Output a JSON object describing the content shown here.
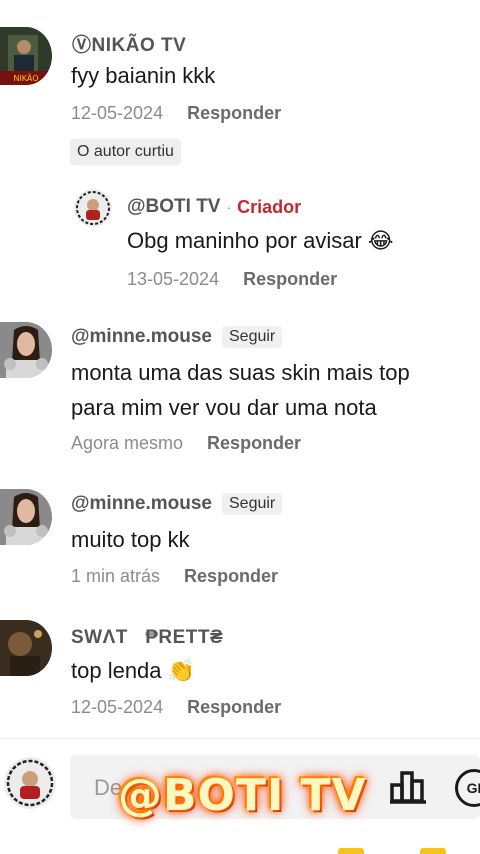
{
  "comments": [
    {
      "author": "ⓋNIKÃO TV",
      "text": "fyy baianin kkk",
      "date": "12-05-2024",
      "reply_label": "Responder",
      "liked_badge": "O autor curtiu"
    },
    {
      "author": "@BOTI TV",
      "creator_dot": "·",
      "creator_badge": "Criador",
      "text": "Obg maninho por avisar 😂",
      "date": "13-05-2024",
      "reply_label": "Responder"
    },
    {
      "author": "@minne.mouse",
      "follow_label": "Seguir",
      "text_lines": [
        "monta uma das suas skin mais top",
        "para mim ver vou dar uma nota"
      ],
      "date": "Agora mesmo",
      "reply_label": "Responder"
    },
    {
      "author": "@minne.mouse",
      "follow_label": "Seguir",
      "text": "muito top kk",
      "date": "1 min atrás",
      "reply_label": "Responder"
    },
    {
      "author": "SWΛT   ₱RETT₴",
      "text": "top lenda 👏",
      "date": "12-05-2024",
      "reply_label": "Responder"
    }
  ],
  "input": {
    "placeholder": "De",
    "icons": [
      "chart-icon",
      "gif-icon"
    ],
    "gif_label": "GI"
  },
  "watermark": "@BOTI TV",
  "colors": {
    "creator": "#c8262e",
    "muted": "#8c8c8c",
    "reply": "#6b6b6b"
  }
}
